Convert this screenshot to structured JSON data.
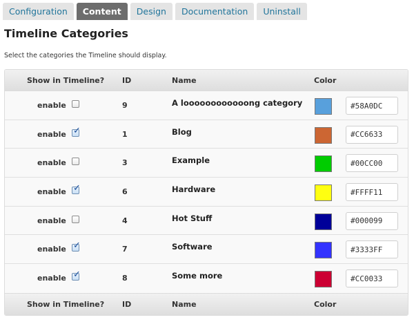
{
  "tabs": [
    {
      "label": "Configuration",
      "active": false
    },
    {
      "label": "Content",
      "active": true
    },
    {
      "label": "Design",
      "active": false
    },
    {
      "label": "Documentation",
      "active": false
    },
    {
      "label": "Uninstall",
      "active": false
    }
  ],
  "page": {
    "title": "Timeline Categories",
    "description": "Select the categories the Timeline should display."
  },
  "table": {
    "headers": {
      "show": "Show in Timeline?",
      "id": "ID",
      "name": "Name",
      "color": "Color"
    },
    "enable_label": "enable",
    "rows": [
      {
        "checked": false,
        "id": "9",
        "name": "A loooooooooooong category",
        "color": "#58A0DC"
      },
      {
        "checked": true,
        "id": "1",
        "name": "Blog",
        "color": "#CC6633"
      },
      {
        "checked": false,
        "id": "3",
        "name": "Example",
        "color": "#00CC00"
      },
      {
        "checked": true,
        "id": "6",
        "name": "Hardware",
        "color": "#FFFF11"
      },
      {
        "checked": false,
        "id": "4",
        "name": "Hot Stuff",
        "color": "#000099"
      },
      {
        "checked": true,
        "id": "7",
        "name": "Software",
        "color": "#3333FF"
      },
      {
        "checked": true,
        "id": "8",
        "name": "Some more",
        "color": "#CC0033"
      }
    ]
  }
}
